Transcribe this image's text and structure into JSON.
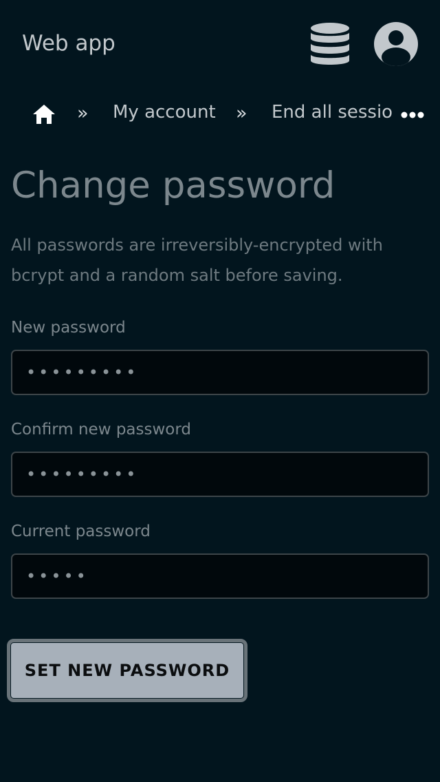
{
  "header": {
    "app_title": "Web app",
    "icons": [
      "database-icon",
      "account-circle-icon"
    ]
  },
  "breadcrumb": {
    "home_icon": "home-icon",
    "separator": "»",
    "my_account": "My account",
    "current": "End all sessions",
    "more_icon": "more-horizontal-icon"
  },
  "main": {
    "title": "Change password",
    "description": "All passwords are irreversibly-encrypted with bcrypt and a random salt before saving.",
    "fields": [
      {
        "label": "New password",
        "value": "987654321"
      },
      {
        "label": "Confirm new password",
        "value": "987654321"
      },
      {
        "label": "Current password",
        "value": "12345"
      }
    ],
    "submit_label": "SET NEW PASSWORD"
  },
  "colors": {
    "background": "#02151e",
    "input_background": "#01080c",
    "button_background": "#a7b0ba",
    "text_muted": "#7c878d"
  }
}
